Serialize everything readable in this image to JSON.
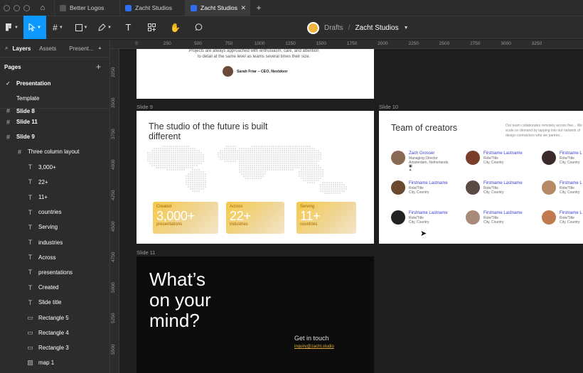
{
  "tabs": [
    {
      "label": "Better Logos",
      "active": false
    },
    {
      "label": "Zacht Studios",
      "active": false
    },
    {
      "label": "Zacht Studios",
      "active": true
    }
  ],
  "toolbar": {
    "breadcrumb_parent": "Drafts",
    "breadcrumb_sep": "/",
    "file_name": "Zacht Studios"
  },
  "leftpanel": {
    "tab_layers": "Layers",
    "tab_assets": "Assets",
    "tab_present": "Present...",
    "pages_heading": "Pages",
    "pages": [
      {
        "label": "Presentation",
        "checked": true
      },
      {
        "label": "Template",
        "checked": false
      }
    ],
    "layers": [
      {
        "label": "Slide 8",
        "indent": 0,
        "icon": "frame"
      },
      {
        "label": "Slide 11",
        "indent": 0,
        "icon": "frame"
      },
      {
        "label": "Slide 9",
        "indent": 0,
        "icon": "frame"
      },
      {
        "label": "Three column layout",
        "indent": 1,
        "icon": "frame"
      },
      {
        "label": "3,000+",
        "indent": 2,
        "icon": "text"
      },
      {
        "label": "22+",
        "indent": 2,
        "icon": "text"
      },
      {
        "label": "11+",
        "indent": 2,
        "icon": "text"
      },
      {
        "label": "countries",
        "indent": 2,
        "icon": "text"
      },
      {
        "label": "Serving",
        "indent": 2,
        "icon": "text"
      },
      {
        "label": "industries",
        "indent": 2,
        "icon": "text"
      },
      {
        "label": "Across",
        "indent": 2,
        "icon": "text"
      },
      {
        "label": "presentations",
        "indent": 2,
        "icon": "text"
      },
      {
        "label": "Created",
        "indent": 2,
        "icon": "text"
      },
      {
        "label": "Slide title",
        "indent": 2,
        "icon": "text"
      },
      {
        "label": "Rectangle 5",
        "indent": 2,
        "icon": "rect"
      },
      {
        "label": "Rectangle 4",
        "indent": 2,
        "icon": "rect"
      },
      {
        "label": "Rectangle 3",
        "indent": 2,
        "icon": "rect"
      },
      {
        "label": "map 1",
        "indent": 2,
        "icon": "image"
      }
    ]
  },
  "rulers": {
    "top": [
      "0",
      "250",
      "500",
      "750",
      "1000",
      "1250",
      "1500",
      "1750",
      "2000",
      "2250",
      "2500",
      "2750",
      "3000",
      "3250"
    ],
    "left": [
      "3250",
      "3500",
      "3750",
      "4000",
      "4250",
      "4500",
      "4750",
      "5000",
      "5250",
      "5500"
    ]
  },
  "canvas": {
    "top_slide": {
      "quote_lines": [
        "Projects are always approached with enthusiasm, care, and attention",
        "to detail at the same level as teams several times their size."
      ],
      "author": "Sarah Friar – CEO, Nextdoor"
    },
    "slide9": {
      "label": "Slide 9",
      "title": "The studio of the future is built different",
      "stats": [
        {
          "label": "Created",
          "value": "3,000+",
          "sub": "presentations"
        },
        {
          "label": "Across",
          "value": "22+",
          "sub": "industries"
        },
        {
          "label": "Serving",
          "value": "11+",
          "sub": "countries"
        }
      ]
    },
    "slide10": {
      "label": "Slide 10",
      "title": "Team of creators",
      "blurb": "Our team collaborates remotely across five... We can scale on demand by tapping into our network of design contractors who we partner...",
      "people": [
        {
          "name": "Zach Grosser",
          "role": "Managing Director",
          "loc": "Amsterdam, Netherlands",
          "color": "#8a6a55",
          "socials": "▣ ✦"
        },
        {
          "name": "Firstname Lastname",
          "role": "Role/Title",
          "loc": "City, Country",
          "color": "#7a3e2a"
        },
        {
          "name": "Firstname L",
          "role": "Role/Title",
          "loc": "City, Country",
          "color": "#3a2a2a"
        },
        {
          "name": "Firstname Lastname",
          "role": "Role/Title",
          "loc": "City, Country",
          "color": "#6a4a2e"
        },
        {
          "name": "Firstname Lastname",
          "role": "Role/Title",
          "loc": "City, Country",
          "color": "#5c4a44"
        },
        {
          "name": "Firstname L",
          "role": "Role/Title",
          "loc": "City, Country",
          "color": "#b78a66"
        },
        {
          "name": "Firstname Lastname",
          "role": "Role/Title",
          "loc": "City, Country",
          "color": "#222222"
        },
        {
          "name": "Firstname Lastname",
          "role": "Role/Title",
          "loc": "City, Country",
          "color": "#a98a78"
        },
        {
          "name": "Firstname L",
          "role": "Role/Title",
          "loc": "City, Country",
          "color": "#c07a4e"
        }
      ]
    },
    "slide11": {
      "label": "Slide 11",
      "headline_lines": [
        "What’s",
        "on your",
        "mind?"
      ],
      "cta": "Get in touch",
      "email": "inquiry@zacht.studio"
    }
  },
  "colors": {
    "accent": "#0d99ff",
    "name_link": "#3a40d9",
    "stat_gold": "#f5c84a"
  }
}
